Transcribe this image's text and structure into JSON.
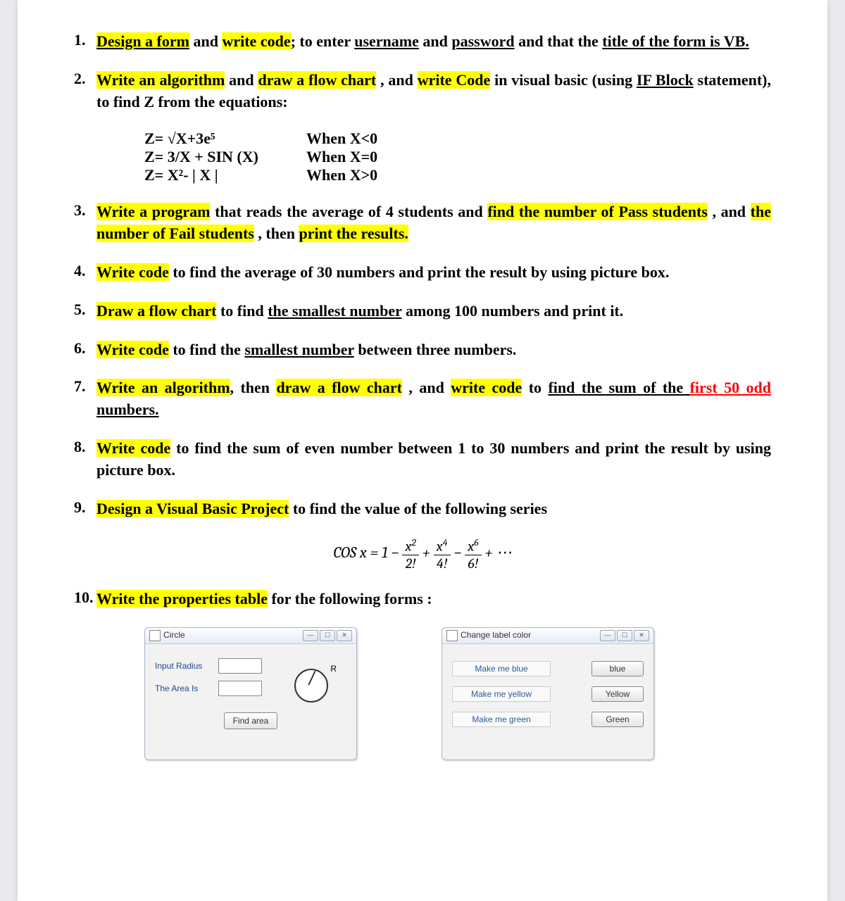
{
  "q1": {
    "p1": "Design a form",
    "t1": " and ",
    "p2": "write code",
    "t2": "; to enter ",
    "u1": "username",
    "t3": " and ",
    "u2": "password",
    "t4": " and that the ",
    "u3": "title of the form is VB."
  },
  "q2": {
    "p1": "Write an algorithm",
    "t1": " and ",
    "p2": "draw a flow chart",
    "t2": " , and ",
    "p3": "write Code",
    "t3": " in visual basic (using ",
    "u1": "IF Block",
    "t4": " statement),  to find Z from the equations:"
  },
  "eq": {
    "l1": "Z= √X+3e⁵",
    "r1": "When X<0",
    "l2": "Z= 3/X + SIN (X)",
    "r2": "When X=0",
    "l3": "Z= X²- | X |",
    "r3": "When X>0"
  },
  "q3": {
    "p1": "Write a program",
    "t1": " that reads the average of 4 students and ",
    "p2": "find the number of Pass students",
    "t2": " , and ",
    "p3": "the number of Fail students",
    "t3": " , then ",
    "p4": "print the results."
  },
  "q4": {
    "sp": " ",
    "p1": "Write code",
    "t1": " to find the average of 30  numbers and print the result by using picture box."
  },
  "q5": {
    "p1": "Draw a flow chart",
    "t1": " to find ",
    "u1": "the smallest number",
    "t2": " among 100 numbers and print it."
  },
  "q6": {
    "p1": "Write code",
    "t1": " to find the ",
    "u1": "smallest number",
    "t2": " between three numbers."
  },
  "q7": {
    "p1": "Write an algorithm",
    "t1": ", then ",
    "p2": "draw a flow chart",
    "t2": " , and ",
    "p3": "write code",
    "t3": " to ",
    "u1": "find the sum of the ",
    "u1red": "first  50 odd",
    "u1b": " numbers."
  },
  "q8": {
    "p1": "Write code",
    "t1": " to find the sum of even number between 1 to 30  numbers and print the result by using picture box."
  },
  "q9": {
    "p1": "Design a Visual Basic Project",
    "t1": " to find the value of the following series"
  },
  "cos": {
    "lhs": "COS x = 1 − ",
    "n1": "x",
    "e1": "2",
    "d1": "2!",
    "plus1": " + ",
    "n2": "x",
    "e2": "4",
    "d2": "4!",
    "minus": " − ",
    "n3": "x",
    "e3": "6",
    "d3": "6!",
    "tail": " + ⋯"
  },
  "q10": {
    "p1": "Write the properties table",
    "t1": " for the following forms :"
  },
  "form1": {
    "title": "Circle",
    "min": "—",
    "max": "☐",
    "close": "✕",
    "label1": "Input Radius",
    "label2": "The Area Is",
    "rlabel": "R",
    "button": "Find area"
  },
  "form2": {
    "title": "Change label color",
    "min": "—",
    "max": "☐",
    "close": "✕",
    "row1": {
      "label": "Make me blue",
      "btn": "blue"
    },
    "row2": {
      "label": "Make me yellow",
      "btn": "Yellow"
    },
    "row3": {
      "label": "Make me green",
      "btn": "Green"
    }
  }
}
